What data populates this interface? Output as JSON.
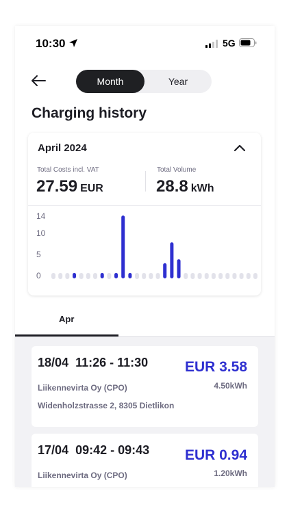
{
  "status_bar": {
    "time": "10:30",
    "network": "5G"
  },
  "header": {
    "segments": [
      "Month",
      "Year"
    ],
    "selected_segment": "Month",
    "title": "Charging history"
  },
  "summary": {
    "period": "April 2024",
    "cost_label": "Total Costs incl. VAT",
    "cost_value": "27.59",
    "cost_unit": "EUR",
    "volume_label": "Total Volume",
    "volume_value": "28.8",
    "volume_unit": "kWh"
  },
  "chart_data": {
    "type": "bar",
    "x": [
      1,
      2,
      3,
      4,
      5,
      6,
      7,
      8,
      9,
      10,
      11,
      12,
      13,
      14,
      15,
      16,
      17,
      18,
      19,
      20,
      21,
      22,
      23,
      24,
      25,
      26,
      27,
      28,
      29,
      30
    ],
    "values": [
      0,
      0,
      0,
      1.2,
      0,
      0,
      0,
      0.94,
      0,
      0.6,
      14.8,
      0.6,
      0,
      0,
      0,
      0,
      3.58,
      8.5,
      4.5,
      0,
      0,
      0,
      0,
      0,
      0,
      0,
      0,
      0,
      0,
      0
    ],
    "yticks": [
      "0",
      "5",
      "10",
      "14"
    ],
    "ylim": [
      0,
      15
    ],
    "bar_color": "#2e2fd0",
    "empty_color": "#e2e2ea"
  },
  "tabs": {
    "active": "Apr"
  },
  "sessions": [
    {
      "date": "18/04",
      "time_range": "11:26 - 11:30",
      "amount": "EUR 3.58",
      "operator": "Liikennevirta Oy (CPO)",
      "energy": "4.50kWh",
      "address": "Widenholzstrasse 2, 8305 Dietlikon"
    },
    {
      "date": "17/04",
      "time_range": "09:42 - 09:43",
      "amount": "EUR 0.94",
      "operator": "Liikennevirta Oy (CPO)",
      "energy": "1.20kWh"
    }
  ],
  "colors": {
    "accent": "#2e2fd0",
    "dark": "#1f2023",
    "muted": "#6d6b80"
  }
}
